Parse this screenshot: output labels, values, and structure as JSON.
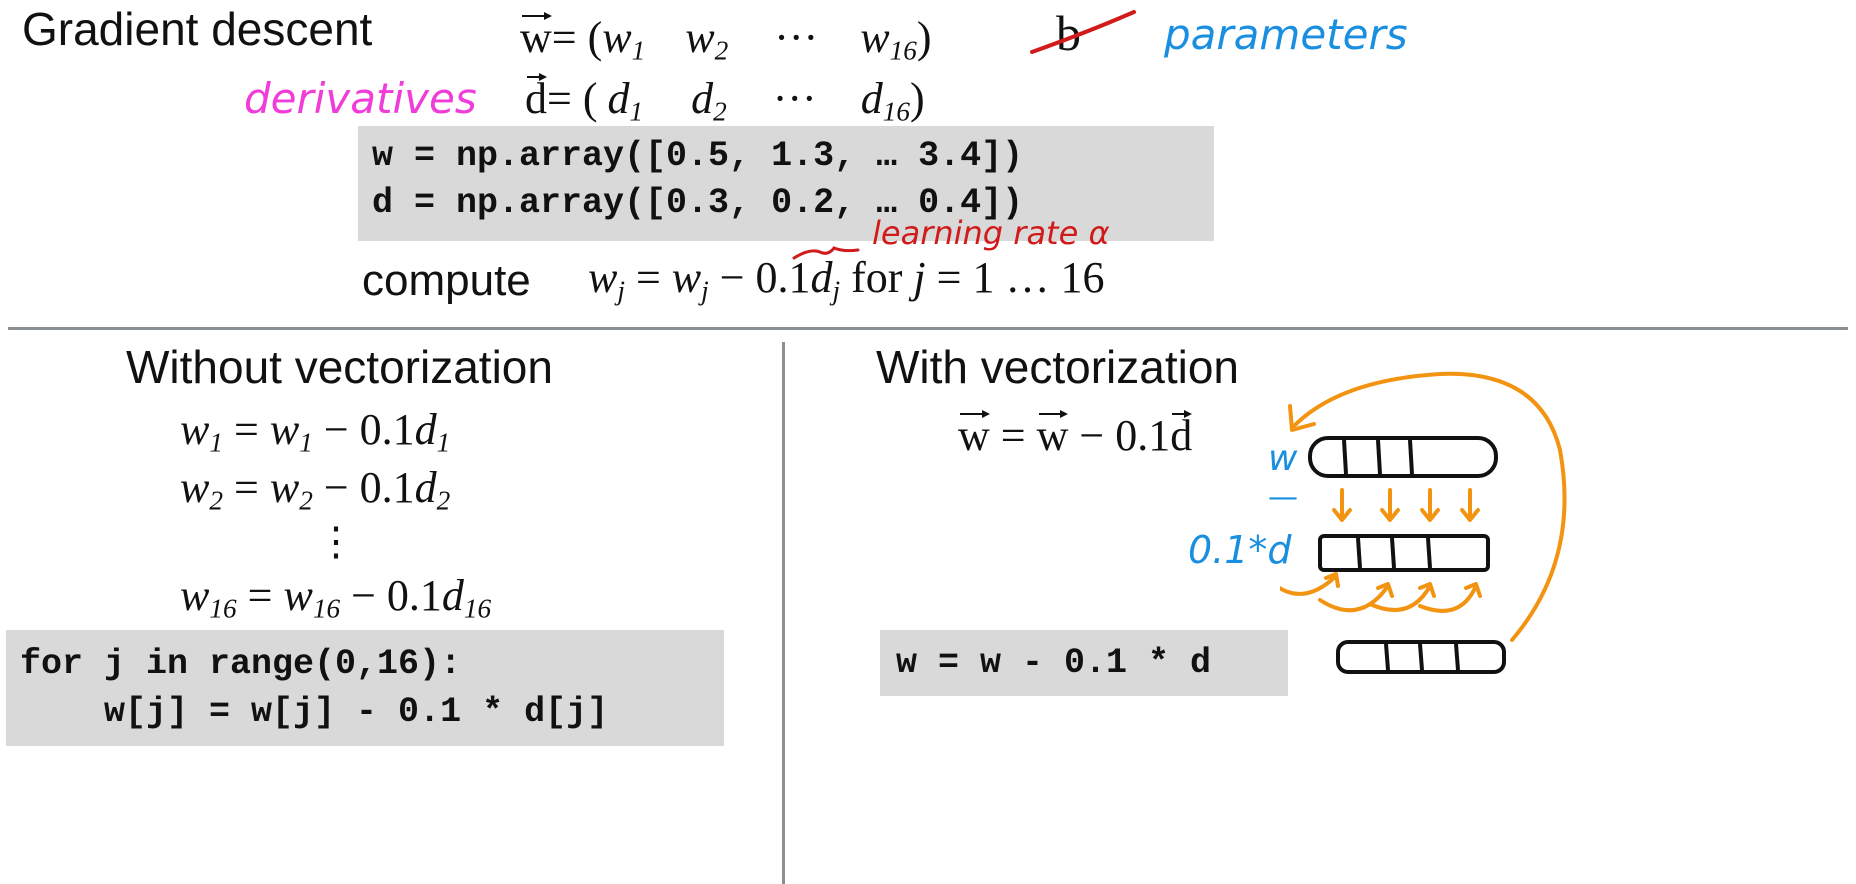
{
  "title": "Gradient descent",
  "vectors": {
    "w_label": "w",
    "w_open": "= (",
    "w1": "w",
    "w1_sub": "1",
    "w2": "w",
    "w2_sub": "2",
    "w_dots": "···",
    "w16": "w",
    "w16_sub": "16",
    "w_close": ")",
    "b_crossed": "b",
    "parameters_note": "parameters",
    "derivatives_note": "derivatives",
    "d_label": "d",
    "d_open": "= (",
    "d1": "d",
    "d1_sub": "1",
    "d2": "d",
    "d2_sub": "2",
    "d_dots": "···",
    "d16": "d",
    "d16_sub": "16",
    "d_close": ")"
  },
  "code_top": {
    "line1": "w = np.array([0.5, 1.3, … 3.4])",
    "line2": "d = np.array([0.3, 0.2, … 0.4])"
  },
  "learning_rate_note": "learning rate α",
  "compute": {
    "word": "compute",
    "formula": "w_j = w_j − 0.1d_j for j = 1 … 16",
    "lhs": "w",
    "lhs_sub": "j",
    "eq": " = ",
    "rhs_w": "w",
    "rhs_w_sub": "j",
    "minus": " − ",
    "rate": "0.1",
    "rhs_d": "d",
    "rhs_d_sub": "j",
    "for_text": " for ",
    "j": "j",
    "range": " = 1 … 16"
  },
  "left": {
    "heading": "Without vectorization",
    "eq1": {
      "a": "w",
      "a_sub": "1",
      "mid": " = ",
      "b": "w",
      "b_sub": "1",
      "op": " − 0.1",
      "c": "d",
      "c_sub": "1"
    },
    "eq2": {
      "a": "w",
      "a_sub": "2",
      "mid": " = ",
      "b": "w",
      "b_sub": "2",
      "op": " − 0.1",
      "c": "d",
      "c_sub": "2"
    },
    "vdots": "⋮",
    "eq16": {
      "a": "w",
      "a_sub": "16",
      "mid": " = ",
      "b": "w",
      "b_sub": "16",
      "op": " − 0.1",
      "c": "d",
      "c_sub": "16"
    },
    "code_line1": "for j in range(0,16):",
    "code_line2": "    w[j] = w[j] - 0.1 * d[j]"
  },
  "right": {
    "heading": "With vectorization",
    "vec_w1": "w",
    "vec_eq": " = ",
    "vec_w2": "w",
    "vec_minus": " − 0.1",
    "vec_d": "d",
    "code": "w = w - 0.1 * d",
    "sketch_w": "w",
    "sketch_minus": "—",
    "sketch_d": "0.1*d"
  },
  "colors": {
    "pink": "#f03cd9",
    "blue": "#1a8fe0",
    "red": "#d11a1a",
    "orange": "#f29411",
    "codebox": "#d9d9d9",
    "divider": "#8a8f94"
  }
}
